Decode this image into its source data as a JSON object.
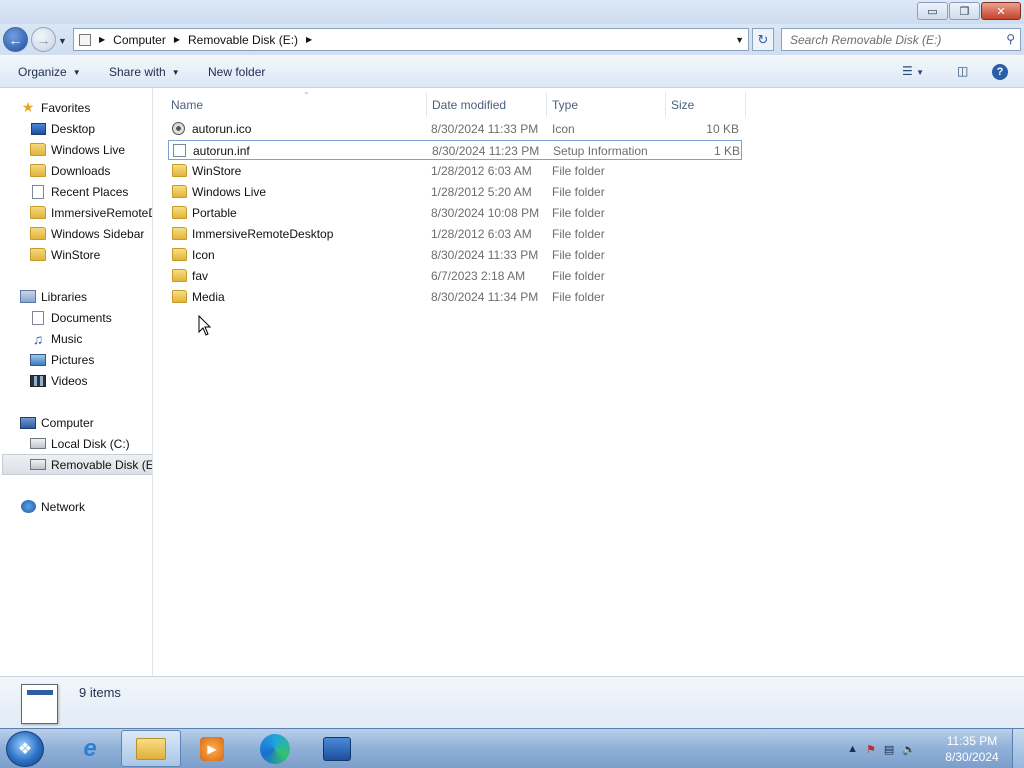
{
  "window": {
    "caption": {
      "minimize": "▭",
      "maximize": "❐",
      "close": "✕"
    }
  },
  "address": {
    "breadcrumbs": [
      "Computer",
      "Removable Disk (E:)"
    ],
    "search_placeholder": "Search Removable Disk (E:)"
  },
  "toolbar": {
    "organize": "Organize",
    "share_with": "Share with",
    "new_folder": "New folder"
  },
  "nav": {
    "favorites": "Favorites",
    "favorites_items": [
      "Desktop",
      "Windows Live",
      "Downloads",
      "Recent Places",
      "ImmersiveRemoteDesktop",
      "Windows Sidebar",
      "WinStore"
    ],
    "libraries": "Libraries",
    "libraries_items": [
      "Documents",
      "Music",
      "Pictures",
      "Videos"
    ],
    "computer": "Computer",
    "computer_items": [
      "Local Disk (C:)",
      "Removable Disk (E:)"
    ],
    "network": "Network"
  },
  "columns": {
    "name": "Name",
    "date": "Date modified",
    "type": "Type",
    "size": "Size"
  },
  "files": [
    {
      "name": "autorun.ico",
      "date": "8/30/2024 11:33 PM",
      "type": "Icon",
      "size": "10 KB",
      "icon": "ico-file-icon"
    },
    {
      "name": "autorun.inf",
      "date": "8/30/2024 11:23 PM",
      "type": "Setup Information",
      "size": "1 KB",
      "icon": "inf-file-icon"
    },
    {
      "name": "WinStore",
      "date": "1/28/2012 6:03 AM",
      "type": "File folder",
      "size": "",
      "icon": "folder-icon"
    },
    {
      "name": "Windows Live",
      "date": "1/28/2012 5:20 AM",
      "type": "File folder",
      "size": "",
      "icon": "folder-icon"
    },
    {
      "name": "Portable",
      "date": "8/30/2024 10:08 PM",
      "type": "File folder",
      "size": "",
      "icon": "folder-icon"
    },
    {
      "name": "ImmersiveRemoteDesktop",
      "date": "1/28/2012 6:03 AM",
      "type": "File folder",
      "size": "",
      "icon": "folder-icon"
    },
    {
      "name": "Icon",
      "date": "8/30/2024 11:33 PM",
      "type": "File folder",
      "size": "",
      "icon": "folder-icon"
    },
    {
      "name": "fav",
      "date": "6/7/2023 2:18 AM",
      "type": "File folder",
      "size": "",
      "icon": "folder-icon"
    },
    {
      "name": "Media",
      "date": "8/30/2024 11:34 PM",
      "type": "File folder",
      "size": "",
      "icon": "folder-icon"
    }
  ],
  "details": {
    "count": "9 items"
  },
  "taskbar": {
    "time": "11:35 PM",
    "date": "8/30/2024",
    "pinned": [
      "internet-explorer-icon",
      "windows-explorer-icon",
      "media-player-icon",
      "edge-icon",
      "store-icon"
    ]
  },
  "colors": {
    "accent": "#2a6fc4",
    "secondary_text": "#6d6d6d"
  }
}
